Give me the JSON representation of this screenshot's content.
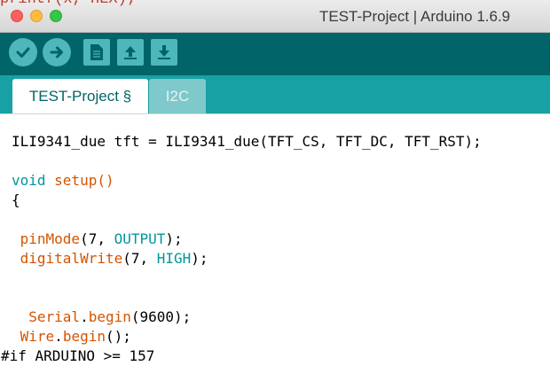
{
  "background": {
    "peek_text": "printf(x, HEX);"
  },
  "window": {
    "title": "TEST-Project | Arduino 1.6.9"
  },
  "toolbar": {
    "buttons": [
      {
        "icon": "verify-check-icon"
      },
      {
        "icon": "upload-arrow-icon"
      },
      {
        "icon": "new-file-icon"
      },
      {
        "icon": "open-up-arrow-icon"
      },
      {
        "icon": "save-down-arrow-icon"
      }
    ]
  },
  "tabs": [
    {
      "label": "TEST-Project §",
      "active": true
    },
    {
      "label": "I2C",
      "active": false
    }
  ],
  "editor": {
    "lines": {
      "l1": "ILI9341_due tft = ILI9341_due(TFT_CS, TFT_DC, TFT_RST);",
      "l3a": "void",
      "l3b": " setup()",
      "l4": "{",
      "l6a": " pinMode",
      "l6b": "(7, ",
      "l6c": "OUTPUT",
      "l6d": ");",
      "l7a": " digitalWrite",
      "l7b": "(7, ",
      "l7c": "HIGH",
      "l7d": ");",
      "l10a": "  Serial",
      "l10b": ".",
      "l10c": "begin",
      "l10d": "(9600);",
      "l11a": " Wire",
      "l11b": ".",
      "l11c": "begin",
      "l11d": "();",
      "l12": "#if ARDUINO >= 157"
    }
  },
  "colors": {
    "toolbar": "#006468",
    "tab_bar": "#17a1a5",
    "keyword": "#00979c",
    "function": "#d35400",
    "highlight": "#fbc71b"
  }
}
